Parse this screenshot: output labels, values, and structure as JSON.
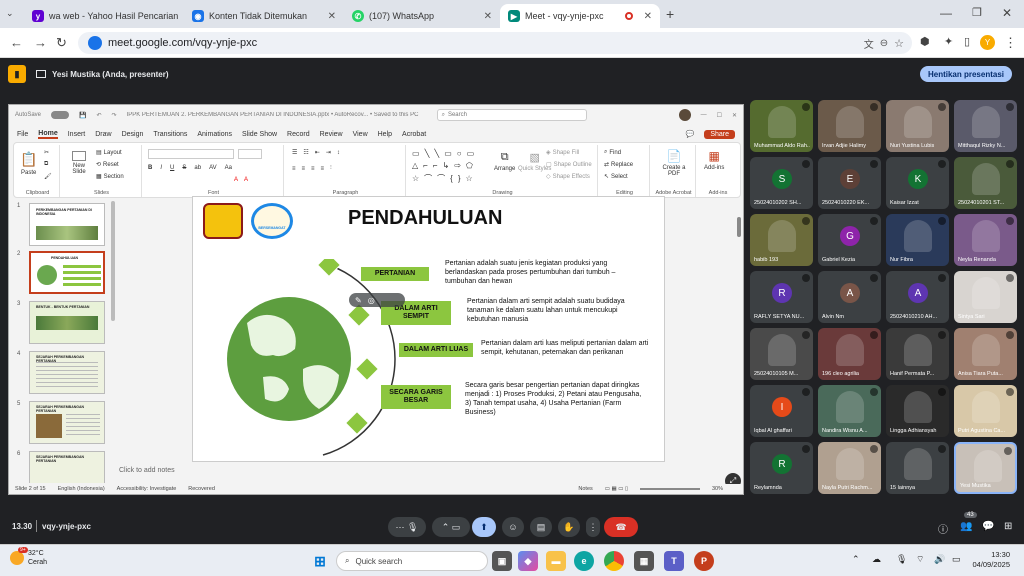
{
  "browser": {
    "tabs": [
      {
        "label": "wa web - Yahoo Hasil Pencarian",
        "icon": "yahoo-icon",
        "color": "#6001d2"
      },
      {
        "label": "Konten Tidak Ditemukan",
        "icon": "globe-icon",
        "color": "#1a73e8"
      },
      {
        "label": "(107) WhatsApp",
        "icon": "whatsapp-icon",
        "color": "#25d366"
      },
      {
        "label": "Meet - vqy-ynje-pxc",
        "icon": "meet-icon",
        "color": "#00897b"
      }
    ],
    "url": "meet.google.com/vqy-ynje-pxc",
    "profile_initial": "Y"
  },
  "meet": {
    "presenter_label": "Yesi Mustika (Anda, presenter)",
    "stop_presenting": "Hentikan presentasi",
    "time": "13.30",
    "meeting_code": "vqy-ynje-pxc",
    "participant_count": "43"
  },
  "ppt": {
    "title_bar": "IPPK PERTEMUAN 2. PERKEMBANGAN PERTANIAN DI INDONESIA.pptx • AutoRecov... • Saved to this PC",
    "autosave": "AutoSave",
    "search_placeholder": "Search",
    "share": "Share",
    "menu": [
      "File",
      "Home",
      "Insert",
      "Draw",
      "Design",
      "Transitions",
      "Animations",
      "Slide Show",
      "Record",
      "Review",
      "View",
      "Help",
      "Acrobat"
    ],
    "ribbon": {
      "paste": "Paste",
      "clipboard": "Clipboard",
      "new_slide": "New Slide",
      "layout": "Layout",
      "reset": "Reset",
      "section": "Section",
      "slides": "Slides",
      "font": "Font",
      "paragraph": "Paragraph",
      "arrange": "Arrange",
      "quick_styles": "Quick Styles",
      "shape_fill": "Shape Fill",
      "shape_outline": "Shape Outline",
      "shape_effects": "Shape Effects",
      "drawing": "Drawing",
      "find": "Find",
      "replace": "Replace",
      "select": "Select",
      "editing": "Editing",
      "create_pdf": "Create a PDF",
      "adobe_acrobat": "Adobe Acrobat",
      "add_ins": "Add-ins",
      "add_ins_group": "Add-ins"
    },
    "thumbnails": [
      {
        "num": "1",
        "title": "PERKEMBANGAN PERTANIAN DI INDONESIA"
      },
      {
        "num": "2",
        "title": "PENDAHULUAN"
      },
      {
        "num": "3",
        "title": "BENTUK - BENTUK PERTANIAN"
      },
      {
        "num": "4",
        "title": "SEJARAH PERKEMBANGAN PERTANIAN"
      },
      {
        "num": "5",
        "title": "SEJARAH PERKEMBANGAN PERTANIAN"
      },
      {
        "num": "6",
        "title": "SEJARAH PERKEMBANGAN PERTANIAN"
      }
    ],
    "slide": {
      "title": "PENDAHULUAN",
      "logo_text": "BERSEMANGAT",
      "items": [
        {
          "label": "PERTANIAN",
          "text": "Pertanian adalah suatu jenis kegiatan produksi yang berlandaskan pada proses pertumbuhan dari tumbuh – tumbuhan dan hewan"
        },
        {
          "label": "DALAM ARTI SEMPIT",
          "text": "Pertanian dalam arti sempit adalah suatu budidaya tanaman ke dalam suatu lahan untuk mencukupi kebutuhan manusia"
        },
        {
          "label": "DALAM ARTI LUAS",
          "text": "Pertanian dalam arti luas meliputi pertanian dalam arti sempit, kehutanan, peternakan dan perikanan"
        },
        {
          "label": "SECARA GARIS BESAR",
          "text": "Secara garis besar pengertian pertanian dapat diringkas menjadi : 1) Proses Produksi, 2) Petani atau Pengusaha, 3) Tanah tempat usaha, 4) Usaha Pertanian (Farm Business)"
        }
      ],
      "accent": "#8cc63f"
    },
    "notes": "Click to add notes",
    "status": {
      "slide_of": "Slide 2 of 15",
      "language": "English (Indonesia)",
      "accessibility": "Accessibility: Investigate",
      "recovered": "Recovered",
      "notes_btn": "Notes",
      "zoom": "30%"
    }
  },
  "participants": [
    {
      "name": "Muhammad Aldo Rah...",
      "initial": "",
      "color": "#556b2f"
    },
    {
      "name": "Irvan Adjie Halimy",
      "initial": "",
      "color": "#6b5a4a"
    },
    {
      "name": "Nuri Yustina Lubis",
      "initial": "",
      "color": "#8a7a70"
    },
    {
      "name": "Mitthaqul Rizky N...",
      "initial": "",
      "color": "#5a5a6a"
    },
    {
      "name": "25024010202 SH...",
      "initial": "S",
      "color": "#137333"
    },
    {
      "name": "25024010220 EK...",
      "initial": "E",
      "color": "#5d4037"
    },
    {
      "name": "Kaisar Izzat",
      "initial": "K",
      "color": "#137333"
    },
    {
      "name": "25024010201 ST...",
      "initial": "",
      "color": "#4a5a3a"
    },
    {
      "name": "habib 193",
      "initial": "",
      "color": "#6b6b3a"
    },
    {
      "name": "Gabriel Kezia",
      "initial": "G",
      "color": "#8e24aa"
    },
    {
      "name": "Nur Fibra",
      "initial": "",
      "color": "#2a3a5a"
    },
    {
      "name": "Neyla Renanda",
      "initial": "",
      "color": "#7a5a8a"
    },
    {
      "name": "RAFLY SETYA NU...",
      "initial": "R",
      "color": "#5e35b1"
    },
    {
      "name": "Alvin Nm",
      "initial": "A",
      "color": "#795548"
    },
    {
      "name": "25024010210 AH...",
      "initial": "A",
      "color": "#5e35b1"
    },
    {
      "name": "Sintya Sari",
      "initial": "",
      "color": "#d8d4d0"
    },
    {
      "name": "25024010105 M...",
      "initial": "",
      "color": "#4a4a4a"
    },
    {
      "name": "196 cleo agrilia",
      "initial": "",
      "color": "#6a3a3a"
    },
    {
      "name": "Hanif Permata P...",
      "initial": "",
      "color": "#3a3a3a"
    },
    {
      "name": "Anisa Tiara Puta...",
      "initial": "",
      "color": "#a08070"
    },
    {
      "name": "Iqbal Al ghaffari",
      "initial": "I",
      "color": "#e64a19"
    },
    {
      "name": "Nandira Wisnu A...",
      "initial": "",
      "color": "#4a6a5a"
    },
    {
      "name": "Lingga Adhiansyah",
      "initial": "",
      "color": "#2a2a2a"
    },
    {
      "name": "Putri Agustina Ca...",
      "initial": "",
      "color": "#d8c8a8"
    },
    {
      "name": "Reylamnda",
      "initial": "R",
      "color": "#137333"
    },
    {
      "name": "Nayla Putri Rachm...",
      "initial": "",
      "color": "#b0a090"
    },
    {
      "name": "15 lainnya",
      "initial": "",
      "color": "#3c4043"
    },
    {
      "name": "Yesi Mustika",
      "initial": "",
      "color": "#c8c0b8"
    }
  ],
  "taskbar": {
    "weather_temp": "32°C",
    "weather_desc": "Cerah",
    "search_placeholder": "Quick search",
    "time": "13:30",
    "date": "04/09/2025",
    "badge": "9+"
  }
}
